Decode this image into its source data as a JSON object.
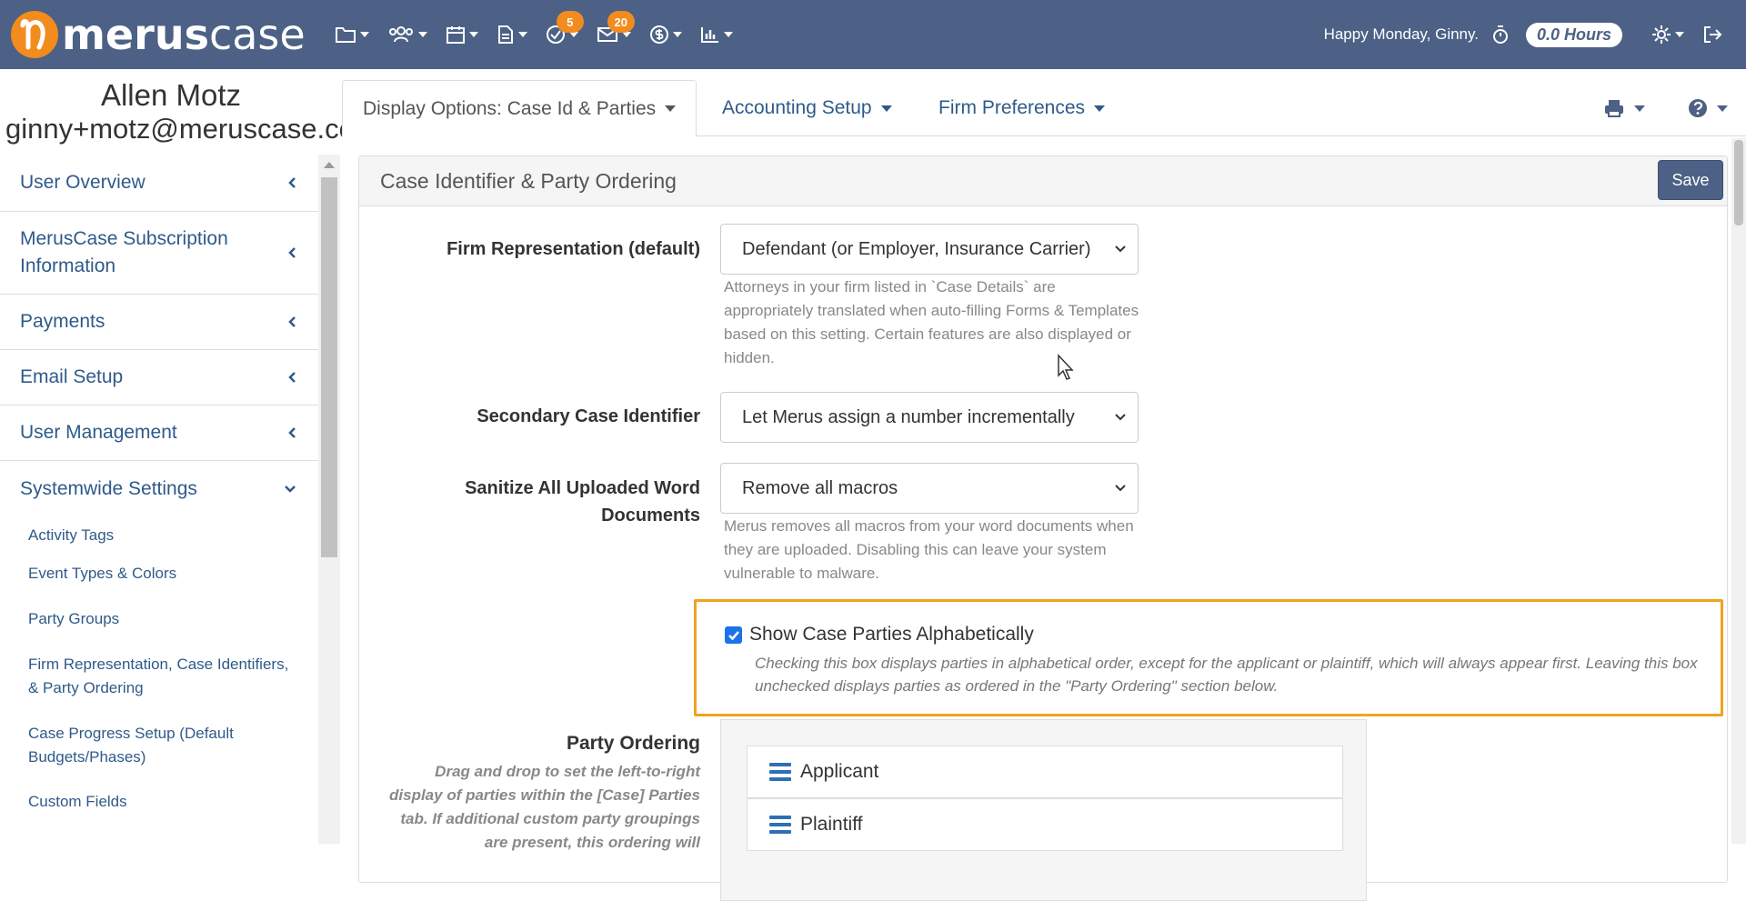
{
  "app": {
    "logo_bold": "merus",
    "logo_light": "case"
  },
  "topbar": {
    "badges": {
      "tasks": "5",
      "mail": "20"
    },
    "greeting": "Happy Monday, Ginny.",
    "hours": "0.0 Hours"
  },
  "user": {
    "name": "Allen Motz",
    "email": "ginny+motz@meruscase.com"
  },
  "sidebar": {
    "items": [
      {
        "label": "User Overview"
      },
      {
        "label": "MerusCase Subscription Information"
      },
      {
        "label": "Payments"
      },
      {
        "label": "Email Setup"
      },
      {
        "label": "User Management"
      },
      {
        "label": "Systemwide Settings"
      }
    ],
    "subitems": [
      {
        "label": "Activity Tags"
      },
      {
        "label": "Event Types & Colors"
      },
      {
        "label": "Party Groups"
      },
      {
        "label": "Firm Representation, Case Identifiers, & Party Ordering"
      },
      {
        "label": "Case Progress Setup (Default Budgets/Phases)"
      },
      {
        "label": "Custom Fields"
      }
    ]
  },
  "tabs": [
    {
      "label": "Display Options: Case Id & Parties"
    },
    {
      "label": "Accounting Setup"
    },
    {
      "label": "Firm Preferences"
    }
  ],
  "panel": {
    "title": "Case Identifier & Party Ordering",
    "save_label": "Save",
    "firm_rep": {
      "label": "Firm Representation (default)",
      "value": "Defendant (or Employer, Insurance Carrier)",
      "help": "Attorneys in your firm listed in `Case Details` are appropriately translated when auto-filling Forms & Templates based on this setting. Certain features are also displayed or hidden."
    },
    "secondary_id": {
      "label": "Secondary Case Identifier",
      "value": "Let Merus assign a number incrementally"
    },
    "sanitize": {
      "label": "Sanitize All Uploaded Word Documents",
      "value": "Remove all macros",
      "help": "Merus removes all macros from your word documents when they are uploaded. Disabling this can leave your system vulnerable to malware."
    },
    "alpha": {
      "label": "Show Case Parties Alphabetically",
      "checked": true,
      "help": "Checking this box displays parties in alphabetical order, except for the applicant or plaintiff, which will always appear first. Leaving this box unchecked displays parties as ordered in the \"Party Ordering\" section below."
    },
    "party_ordering": {
      "label": "Party Ordering",
      "help": "Drag and drop to set the left-to-right display of parties within the [Case] Parties tab. If additional custom party groupings are present, this ordering will",
      "items": [
        {
          "label": "Applicant"
        },
        {
          "label": "Plaintiff"
        }
      ]
    }
  },
  "colors": {
    "navbar": "#4c6185",
    "accent": "#f28c1e",
    "link": "#2f5a8a",
    "highlight": "#f0a31e"
  }
}
